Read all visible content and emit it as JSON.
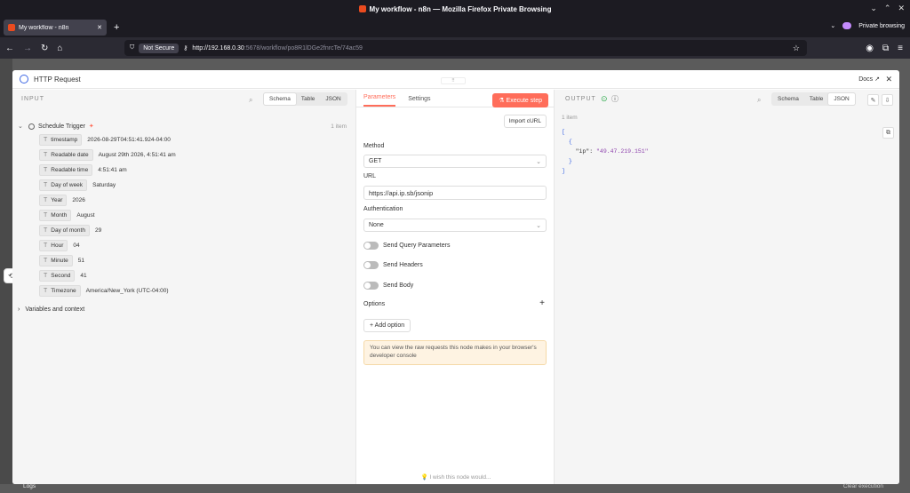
{
  "window": {
    "title": "My workflow - n8n — Mozilla Firefox Private Browsing"
  },
  "tab": {
    "label": "My workflow - n8n"
  },
  "private": {
    "label": "Private browsing"
  },
  "url": {
    "security": "Not Secure",
    "host": "http://192.168.0.30",
    "path": ":5678/workflow/po8R1lDGe2fnrcTe/74ac59"
  },
  "node": {
    "title": "HTTP Request",
    "docs": "Docs",
    "drag": "⠿"
  },
  "input": {
    "label": "INPUT",
    "views": [
      "Schema",
      "Table",
      "JSON"
    ],
    "active_view": "Schema",
    "trigger": "Schedule Trigger",
    "item_count": "1 item",
    "fields": [
      {
        "name": "timestamp",
        "value": "2026-08-29T04:51:41.924-04:00"
      },
      {
        "name": "Readable date",
        "value": "August 29th 2026, 4:51:41 am"
      },
      {
        "name": "Readable time",
        "value": "4:51:41 am"
      },
      {
        "name": "Day of week",
        "value": "Saturday"
      },
      {
        "name": "Year",
        "value": "2026"
      },
      {
        "name": "Month",
        "value": "August"
      },
      {
        "name": "Day of month",
        "value": "29"
      },
      {
        "name": "Hour",
        "value": "04"
      },
      {
        "name": "Minute",
        "value": "51"
      },
      {
        "name": "Second",
        "value": "41"
      },
      {
        "name": "Timezone",
        "value": "America/New_York (UTC-04:00)"
      }
    ],
    "variables": "Variables and context"
  },
  "params": {
    "tabs": [
      "Parameters",
      "Settings"
    ],
    "execute": "Execute step",
    "import_curl": "Import cURL",
    "method_label": "Method",
    "method": "GET",
    "url_label": "URL",
    "url": "https://api.ip.sb/jsonip",
    "auth_label": "Authentication",
    "auth": "None",
    "toggles": [
      "Send Query Parameters",
      "Send Headers",
      "Send Body"
    ],
    "options_label": "Options",
    "add_option": "Add option",
    "notice": "You can view the raw requests this node makes in your browser's developer console",
    "wish": "I wish this node would..."
  },
  "output": {
    "label": "OUTPUT",
    "views": [
      "Schema",
      "Table",
      "JSON"
    ],
    "active_view": "JSON",
    "item_count": "1 item",
    "json_key": "\"ip\"",
    "json_value": "\"49.47.219.151\""
  },
  "footer": {
    "logs": "Logs",
    "clear": "Clear execution"
  }
}
